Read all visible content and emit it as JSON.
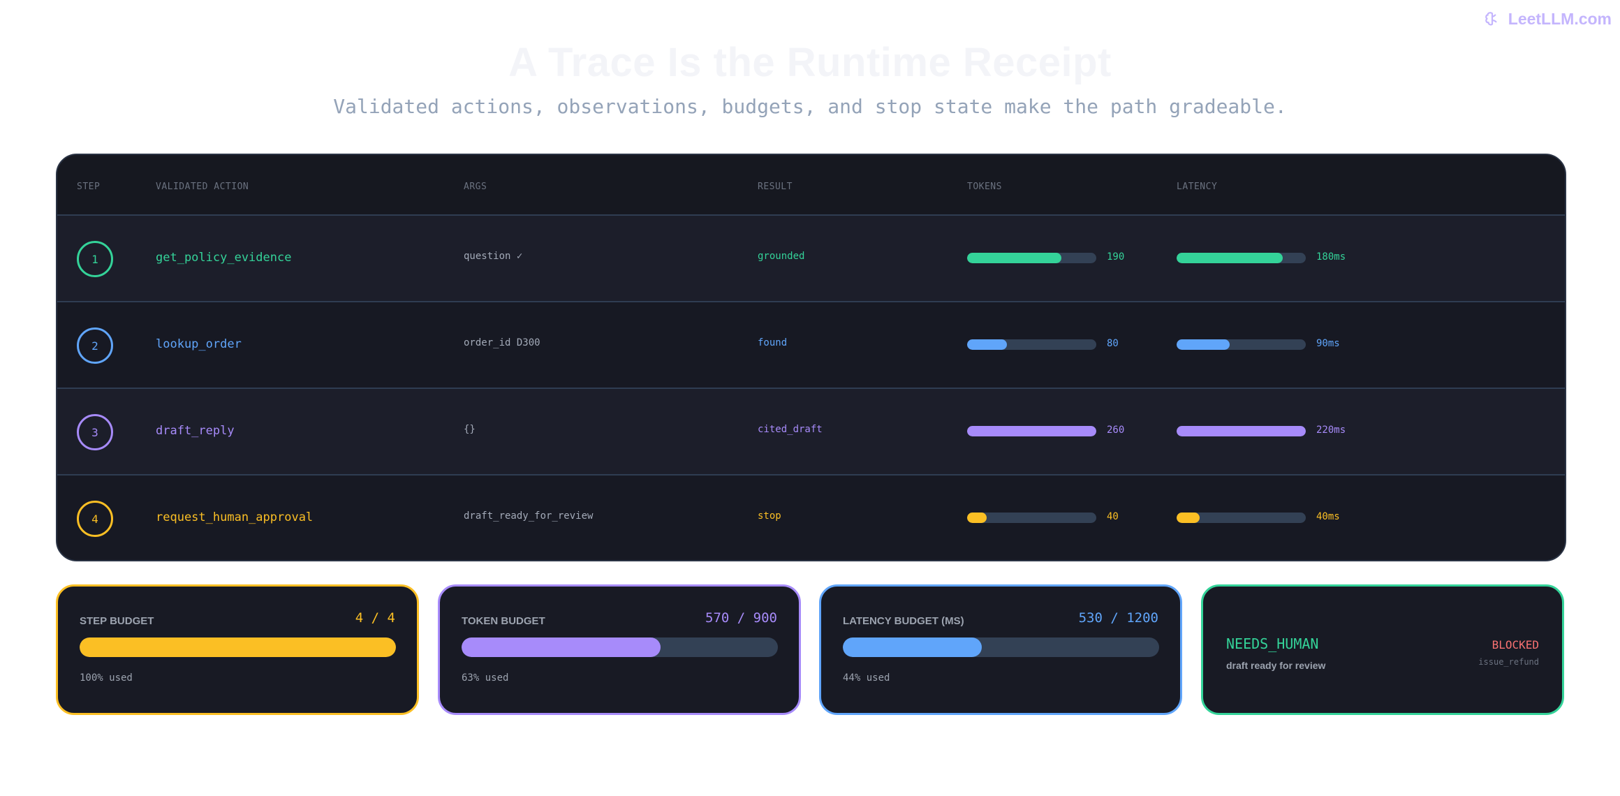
{
  "brand": {
    "name": "LeetLLM.com"
  },
  "header": {
    "title": "A Trace Is the Runtime Receipt",
    "subtitle": "Validated actions, observations, budgets, and stop state make the path gradeable."
  },
  "table": {
    "columns": {
      "step": "STEP",
      "action": "VALIDATED ACTION",
      "args": "ARGS",
      "result": "RESULT",
      "tokens": "TOKENS",
      "latency": "LATENCY"
    },
    "rows": [
      {
        "step": "1",
        "action": "get_policy_evidence",
        "args": "question ✓",
        "result": "grounded",
        "tokens": "190",
        "tokens_fill": 0.73,
        "latency": "180ms",
        "latency_fill": 0.82,
        "color": "#34d399"
      },
      {
        "step": "2",
        "action": "lookup_order",
        "args": "order_id D300",
        "result": "found",
        "tokens": "80",
        "tokens_fill": 0.31,
        "latency": "90ms",
        "latency_fill": 0.41,
        "color": "#60a5fa"
      },
      {
        "step": "3",
        "action": "draft_reply",
        "args": "{}",
        "result": "cited_draft",
        "tokens": "260",
        "tokens_fill": 1.0,
        "latency": "220ms",
        "latency_fill": 1.0,
        "color": "#a78bfa"
      },
      {
        "step": "4",
        "action": "request_human_approval",
        "args": "draft_ready_for_review",
        "result": "stop",
        "tokens": "40",
        "tokens_fill": 0.15,
        "latency": "40ms",
        "latency_fill": 0.18,
        "color": "#fbbf24"
      }
    ]
  },
  "budgets": [
    {
      "label": "STEP BUDGET",
      "value": "4 / 4",
      "used": "100% used",
      "fill": 1.0,
      "color": "#fbbf24"
    },
    {
      "label": "TOKEN BUDGET",
      "value": "570 / 900",
      "used": "63% used",
      "fill": 0.63,
      "color": "#a78bfa"
    },
    {
      "label": "LATENCY BUDGET (MS)",
      "value": "530 / 1200",
      "used": "44% used",
      "fill": 0.44,
      "color": "#60a5fa"
    }
  ],
  "stop": {
    "state": "NEEDS_HUMAN",
    "note": "draft ready for review",
    "badge": "BLOCKED",
    "tool": "issue_refund",
    "color": "#34d399"
  }
}
